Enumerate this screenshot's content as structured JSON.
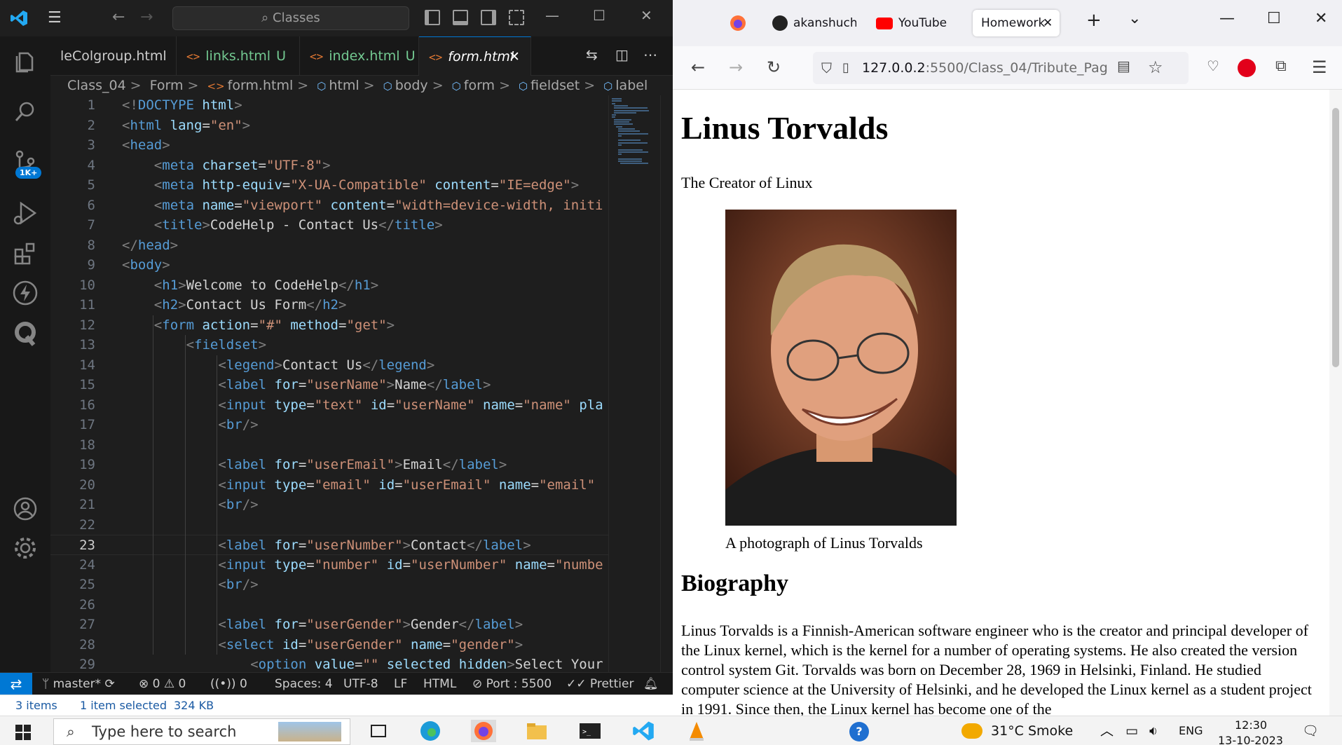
{
  "vscode": {
    "search_placeholder": "Classes",
    "tabs": [
      {
        "label": "leColgroup.html",
        "suffix": ""
      },
      {
        "label": "links.html",
        "suffix": "U"
      },
      {
        "label": "index.html",
        "suffix": "U"
      },
      {
        "label": "form.html",
        "suffix": ""
      }
    ],
    "breadcrumb": [
      "Class_04",
      "Form",
      "form.html",
      "html",
      "body",
      "form",
      "fieldset",
      "label"
    ],
    "badge": "1K+",
    "lines": [
      {
        "n": "1",
        "tokens": [
          [
            "br",
            "<!"
          ],
          [
            "tag",
            "DOCTYPE"
          ],
          [
            "txt",
            " "
          ],
          [
            "attr",
            "html"
          ],
          [
            "br",
            ">"
          ]
        ],
        "indent": 0
      },
      {
        "n": "2",
        "tokens": [
          [
            "br",
            "<"
          ],
          [
            "tag",
            "html"
          ],
          [
            "txt",
            " "
          ],
          [
            "attr",
            "lang"
          ],
          [
            "txt",
            "="
          ],
          [
            "str",
            "\"en\""
          ],
          [
            "br",
            ">"
          ]
        ],
        "indent": 0
      },
      {
        "n": "3",
        "tokens": [
          [
            "br",
            "<"
          ],
          [
            "tag",
            "head"
          ],
          [
            "br",
            ">"
          ]
        ],
        "indent": 0
      },
      {
        "n": "4",
        "tokens": [
          [
            "br",
            "<"
          ],
          [
            "tag",
            "meta"
          ],
          [
            "txt",
            " "
          ],
          [
            "attr",
            "charset"
          ],
          [
            "txt",
            "="
          ],
          [
            "str",
            "\"UTF-8\""
          ],
          [
            "br",
            ">"
          ]
        ],
        "indent": 1
      },
      {
        "n": "5",
        "tokens": [
          [
            "br",
            "<"
          ],
          [
            "tag",
            "meta"
          ],
          [
            "txt",
            " "
          ],
          [
            "attr",
            "http-equiv"
          ],
          [
            "txt",
            "="
          ],
          [
            "str",
            "\"X-UA-Compatible\""
          ],
          [
            "txt",
            " "
          ],
          [
            "attr",
            "content"
          ],
          [
            "txt",
            "="
          ],
          [
            "str",
            "\"IE=edge\""
          ],
          [
            "br",
            ">"
          ]
        ],
        "indent": 1
      },
      {
        "n": "6",
        "tokens": [
          [
            "br",
            "<"
          ],
          [
            "tag",
            "meta"
          ],
          [
            "txt",
            " "
          ],
          [
            "attr",
            "name"
          ],
          [
            "txt",
            "="
          ],
          [
            "str",
            "\"viewport\""
          ],
          [
            "txt",
            " "
          ],
          [
            "attr",
            "content"
          ],
          [
            "txt",
            "="
          ],
          [
            "str",
            "\"width=device-width, initi"
          ]
        ],
        "indent": 1
      },
      {
        "n": "7",
        "tokens": [
          [
            "br",
            "<"
          ],
          [
            "tag",
            "title"
          ],
          [
            "br",
            ">"
          ],
          [
            "txt",
            "CodeHelp - Contact Us"
          ],
          [
            "br",
            "</"
          ],
          [
            "tag",
            "title"
          ],
          [
            "br",
            ">"
          ]
        ],
        "indent": 1
      },
      {
        "n": "8",
        "tokens": [
          [
            "br",
            "</"
          ],
          [
            "tag",
            "head"
          ],
          [
            "br",
            ">"
          ]
        ],
        "indent": 0
      },
      {
        "n": "9",
        "tokens": [
          [
            "br",
            "<"
          ],
          [
            "tag",
            "body"
          ],
          [
            "br",
            ">"
          ]
        ],
        "indent": 0
      },
      {
        "n": "10",
        "tokens": [
          [
            "br",
            "<"
          ],
          [
            "tag",
            "h1"
          ],
          [
            "br",
            ">"
          ],
          [
            "txt",
            "Welcome to CodeHelp"
          ],
          [
            "br",
            "</"
          ],
          [
            "tag",
            "h1"
          ],
          [
            "br",
            ">"
          ]
        ],
        "indent": 1
      },
      {
        "n": "11",
        "tokens": [
          [
            "br",
            "<"
          ],
          [
            "tag",
            "h2"
          ],
          [
            "br",
            ">"
          ],
          [
            "txt",
            "Contact Us Form"
          ],
          [
            "br",
            "</"
          ],
          [
            "tag",
            "h2"
          ],
          [
            "br",
            ">"
          ]
        ],
        "indent": 1
      },
      {
        "n": "12",
        "tokens": [
          [
            "br",
            "<"
          ],
          [
            "tag",
            "form"
          ],
          [
            "txt",
            " "
          ],
          [
            "attr",
            "action"
          ],
          [
            "txt",
            "="
          ],
          [
            "str",
            "\"#\""
          ],
          [
            "txt",
            " "
          ],
          [
            "attr",
            "method"
          ],
          [
            "txt",
            "="
          ],
          [
            "str",
            "\"get\""
          ],
          [
            "br",
            ">"
          ]
        ],
        "indent": 1
      },
      {
        "n": "13",
        "tokens": [
          [
            "br",
            "<"
          ],
          [
            "tag",
            "fieldset"
          ],
          [
            "br",
            ">"
          ]
        ],
        "indent": 2
      },
      {
        "n": "14",
        "tokens": [
          [
            "br",
            "<"
          ],
          [
            "tag",
            "legend"
          ],
          [
            "br",
            ">"
          ],
          [
            "txt",
            "Contact Us"
          ],
          [
            "br",
            "</"
          ],
          [
            "tag",
            "legend"
          ],
          [
            "br",
            ">"
          ]
        ],
        "indent": 3
      },
      {
        "n": "15",
        "tokens": [
          [
            "br",
            "<"
          ],
          [
            "tag",
            "label"
          ],
          [
            "txt",
            " "
          ],
          [
            "attr",
            "for"
          ],
          [
            "txt",
            "="
          ],
          [
            "str",
            "\"userName\""
          ],
          [
            "br",
            ">"
          ],
          [
            "txt",
            "Name"
          ],
          [
            "br",
            "</"
          ],
          [
            "tag",
            "label"
          ],
          [
            "br",
            ">"
          ]
        ],
        "indent": 3
      },
      {
        "n": "16",
        "tokens": [
          [
            "br",
            "<"
          ],
          [
            "tag",
            "input"
          ],
          [
            "txt",
            " "
          ],
          [
            "attr",
            "type"
          ],
          [
            "txt",
            "="
          ],
          [
            "str",
            "\"text\""
          ],
          [
            "txt",
            " "
          ],
          [
            "attr",
            "id"
          ],
          [
            "txt",
            "="
          ],
          [
            "str",
            "\"userName\""
          ],
          [
            "txt",
            " "
          ],
          [
            "attr",
            "name"
          ],
          [
            "txt",
            "="
          ],
          [
            "str",
            "\"name\""
          ],
          [
            "txt",
            " "
          ],
          [
            "attr",
            "pla"
          ]
        ],
        "indent": 3
      },
      {
        "n": "17",
        "tokens": [
          [
            "br",
            "<"
          ],
          [
            "tag",
            "br"
          ],
          [
            "br",
            "/>"
          ]
        ],
        "indent": 3
      },
      {
        "n": "18",
        "tokens": [],
        "indent": 3
      },
      {
        "n": "19",
        "tokens": [
          [
            "br",
            "<"
          ],
          [
            "tag",
            "label"
          ],
          [
            "txt",
            " "
          ],
          [
            "attr",
            "for"
          ],
          [
            "txt",
            "="
          ],
          [
            "str",
            "\"userEmail\""
          ],
          [
            "br",
            ">"
          ],
          [
            "txt",
            "Email"
          ],
          [
            "br",
            "</"
          ],
          [
            "tag",
            "label"
          ],
          [
            "br",
            ">"
          ]
        ],
        "indent": 3
      },
      {
        "n": "20",
        "tokens": [
          [
            "br",
            "<"
          ],
          [
            "tag",
            "input"
          ],
          [
            "txt",
            " "
          ],
          [
            "attr",
            "type"
          ],
          [
            "txt",
            "="
          ],
          [
            "str",
            "\"email\""
          ],
          [
            "txt",
            " "
          ],
          [
            "attr",
            "id"
          ],
          [
            "txt",
            "="
          ],
          [
            "str",
            "\"userEmail\""
          ],
          [
            "txt",
            " "
          ],
          [
            "attr",
            "name"
          ],
          [
            "txt",
            "="
          ],
          [
            "str",
            "\"email\""
          ]
        ],
        "indent": 3
      },
      {
        "n": "21",
        "tokens": [
          [
            "br",
            "<"
          ],
          [
            "tag",
            "br"
          ],
          [
            "br",
            "/>"
          ]
        ],
        "indent": 3
      },
      {
        "n": "22",
        "tokens": [],
        "indent": 3
      },
      {
        "n": "23",
        "tokens": [
          [
            "br",
            "<"
          ],
          [
            "tag",
            "label"
          ],
          [
            "txt",
            " "
          ],
          [
            "attr",
            "for"
          ],
          [
            "txt",
            "="
          ],
          [
            "str",
            "\"userNumber\""
          ],
          [
            "br",
            ">"
          ],
          [
            "txt",
            "Contact"
          ],
          [
            "br",
            "</"
          ],
          [
            "tag",
            "label"
          ],
          [
            "br",
            ">"
          ]
        ],
        "indent": 3
      },
      {
        "n": "24",
        "tokens": [
          [
            "br",
            "<"
          ],
          [
            "tag",
            "input"
          ],
          [
            "txt",
            " "
          ],
          [
            "attr",
            "type"
          ],
          [
            "txt",
            "="
          ],
          [
            "str",
            "\"number\""
          ],
          [
            "txt",
            " "
          ],
          [
            "attr",
            "id"
          ],
          [
            "txt",
            "="
          ],
          [
            "str",
            "\"userNumber\""
          ],
          [
            "txt",
            " "
          ],
          [
            "attr",
            "name"
          ],
          [
            "txt",
            "="
          ],
          [
            "str",
            "\"numbe"
          ]
        ],
        "indent": 3
      },
      {
        "n": "25",
        "tokens": [
          [
            "br",
            "<"
          ],
          [
            "tag",
            "br"
          ],
          [
            "br",
            "/>"
          ]
        ],
        "indent": 3
      },
      {
        "n": "26",
        "tokens": [],
        "indent": 3
      },
      {
        "n": "27",
        "tokens": [
          [
            "br",
            "<"
          ],
          [
            "tag",
            "label"
          ],
          [
            "txt",
            " "
          ],
          [
            "attr",
            "for"
          ],
          [
            "txt",
            "="
          ],
          [
            "str",
            "\"userGender\""
          ],
          [
            "br",
            ">"
          ],
          [
            "txt",
            "Gender"
          ],
          [
            "br",
            "</"
          ],
          [
            "tag",
            "label"
          ],
          [
            "br",
            ">"
          ]
        ],
        "indent": 3
      },
      {
        "n": "28",
        "tokens": [
          [
            "br",
            "<"
          ],
          [
            "tag",
            "select"
          ],
          [
            "txt",
            " "
          ],
          [
            "attr",
            "id"
          ],
          [
            "txt",
            "="
          ],
          [
            "str",
            "\"userGender\""
          ],
          [
            "txt",
            " "
          ],
          [
            "attr",
            "name"
          ],
          [
            "txt",
            "="
          ],
          [
            "str",
            "\"gender\""
          ],
          [
            "br",
            ">"
          ]
        ],
        "indent": 3
      },
      {
        "n": "29",
        "tokens": [
          [
            "br",
            "<"
          ],
          [
            "tag",
            "option"
          ],
          [
            "txt",
            " "
          ],
          [
            "attr",
            "value"
          ],
          [
            "txt",
            "="
          ],
          [
            "str",
            "\"\""
          ],
          [
            "txt",
            " "
          ],
          [
            "attr",
            "selected"
          ],
          [
            "txt",
            " "
          ],
          [
            "attr",
            "hidden"
          ],
          [
            "br",
            ">"
          ],
          [
            "txt",
            "Select Your"
          ]
        ],
        "indent": 4
      }
    ],
    "current_line": "23",
    "status": {
      "branch": "master*",
      "errors": "0",
      "warnings": "0",
      "ports": "0",
      "spaces": "Spaces: 4",
      "encoding": "UTF-8",
      "eol": "LF",
      "language": "HTML",
      "port": "Port : 5500",
      "prettier": "Prettier"
    },
    "explorer_status": {
      "items": "3 items",
      "selected": "1 item selected",
      "size": "324 KB"
    }
  },
  "browser": {
    "tabs": [
      {
        "label": "akanshuch"
      },
      {
        "label": "YouTube"
      },
      {
        "label": "Homework"
      }
    ],
    "url_host": "127.0.0.2",
    "url_path": ":5500/Class_04/Tribute_Pag",
    "page": {
      "title": "Linus Torvalds",
      "subtitle": "The Creator of Linux",
      "caption": "A photograph of Linus Torvalds",
      "section_heading": "Biography",
      "paragraph": "Linus Torvalds is a Finnish-American software engineer who is the creator and principal developer of the Linux kernel, which is the kernel for a number of operating systems. He also created the version control system Git. Torvalds was born on December 28, 1969 in Helsinki, Finland. He studied computer science at the University of Helsinki, and he developed the Linux kernel as a student project in 1991. Since then, the Linux kernel has become one of the"
    }
  },
  "taskbar": {
    "search_placeholder": "Type here to search",
    "weather": "31°C  Smoke",
    "language": "ENG",
    "time": "12:30",
    "date": "13-10-2023"
  },
  "colors": {
    "accent": "#0078d4",
    "tag": "#569cd6",
    "attr": "#9cdcfe",
    "string": "#ce9178",
    "html_icon": "#e37933"
  }
}
